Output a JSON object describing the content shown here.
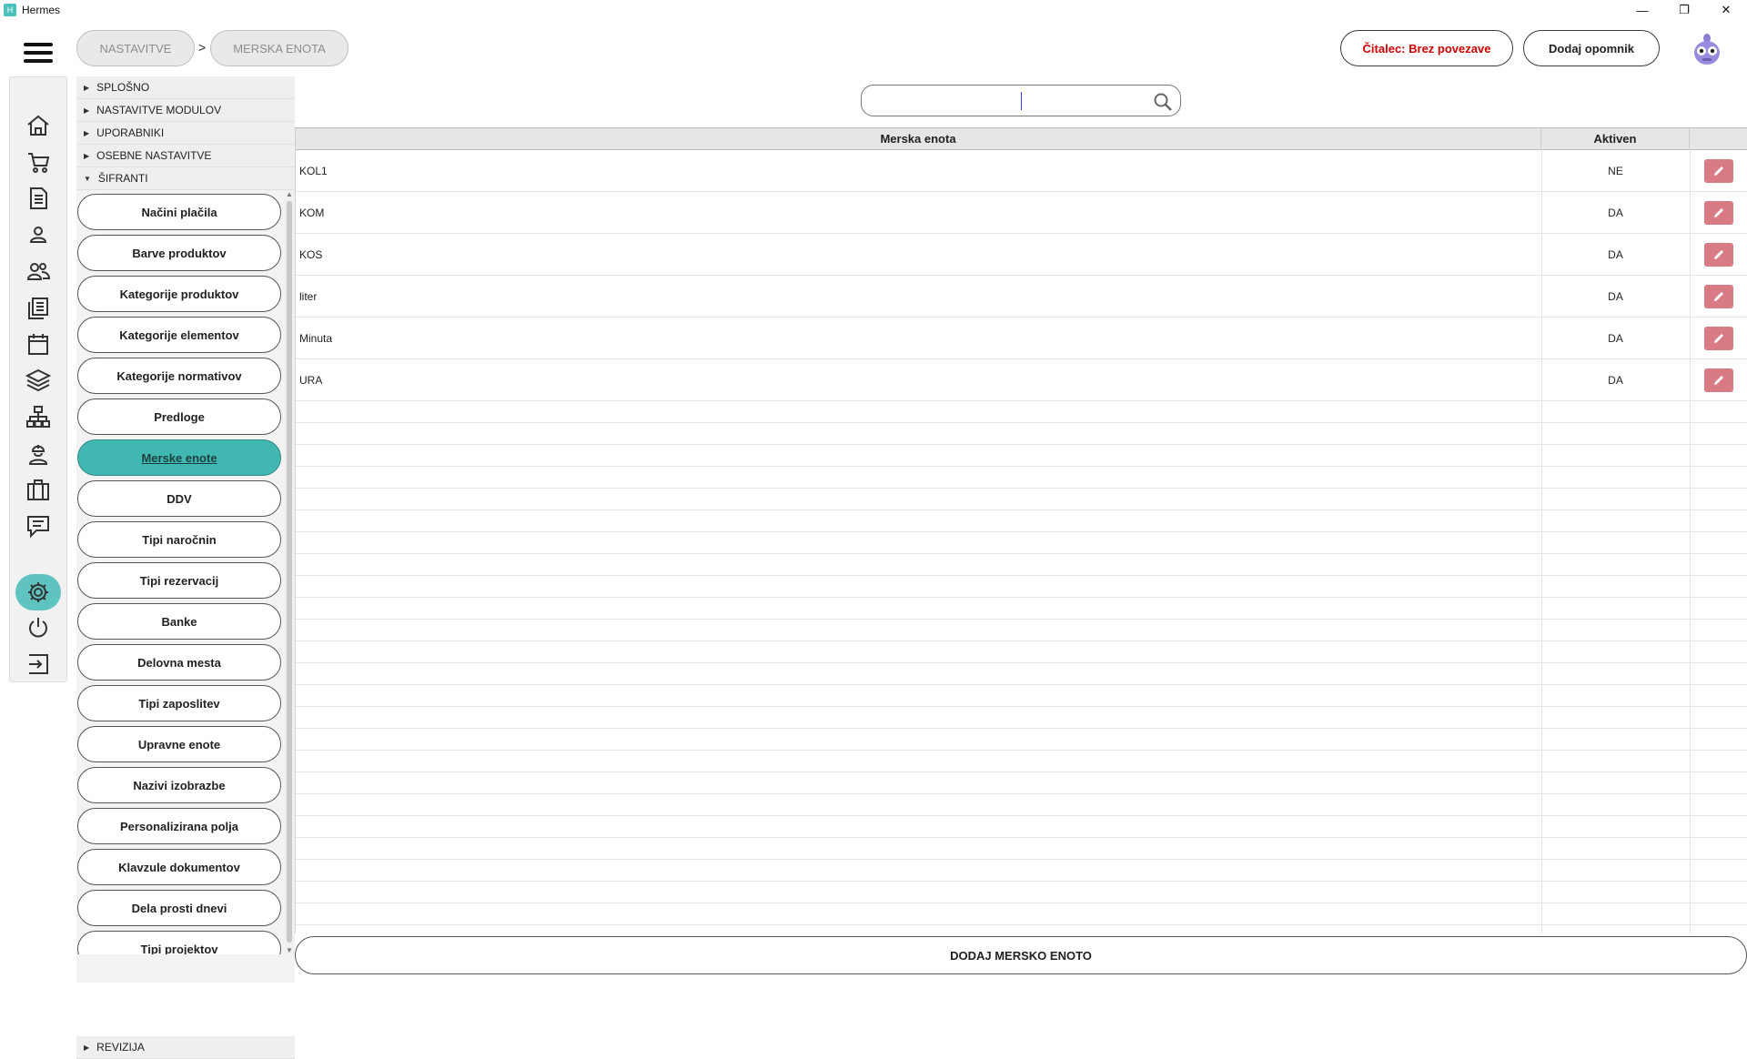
{
  "window": {
    "title": "Hermes"
  },
  "header": {
    "breadcrumb": [
      "NASTAVITVE",
      "MERSKA ENOTA"
    ],
    "breadcrumb_separator": ">",
    "reader_status": "Čitalec: Brez povezave",
    "reader_status_color": "#d10000",
    "add_reminder": "Dodaj opomnik"
  },
  "rail": {
    "icons": [
      "home-icon",
      "cart-icon",
      "invoice-icon",
      "person-icon",
      "people-icon",
      "documents-icon",
      "calendar-icon",
      "layers-icon",
      "network-icon",
      "worker-icon",
      "briefcase-icon",
      "chat-icon",
      "settings-icon",
      "power-icon",
      "logout-icon"
    ],
    "active": "settings-icon"
  },
  "tree": {
    "sections_top": [
      "SPLOŠNO",
      "NASTAVITVE MODULOV",
      "UPORABNIKI",
      "OSEBNE NASTAVITVE",
      "ŠIFRANTI"
    ],
    "expanded_section": "ŠIFRANTI",
    "items": [
      "Načini plačila",
      "Barve produktov",
      "Kategorije produktov",
      "Kategorije elementov",
      "Kategorije normativov",
      "Predloge",
      "Merske enote",
      "DDV",
      "Tipi naročnin",
      "Tipi rezervacij",
      "Banke",
      "Delovna mesta",
      "Tipi zaposlitev",
      "Upravne enote",
      "Nazivi izobrazbe",
      "Personalizirana polja",
      "Klavzule dokumentov",
      "Dela prosti dnevi",
      "Tipi projektov"
    ],
    "active_item": "Merske enote",
    "section_bottom": "REVIZIJA"
  },
  "search": {
    "value": "",
    "placeholder": ""
  },
  "grid": {
    "columns": [
      "Merska enota",
      "Aktiven"
    ],
    "rows": [
      {
        "name": "KOL1",
        "active": "NE"
      },
      {
        "name": "KOM",
        "active": "DA"
      },
      {
        "name": "KOS",
        "active": "DA"
      },
      {
        "name": "liter",
        "active": "DA"
      },
      {
        "name": "Minuta",
        "active": "DA"
      },
      {
        "name": "URA",
        "active": "DA"
      }
    ]
  },
  "footer": {
    "add_button": "DODAJ MERSKO ENOTO"
  },
  "colors": {
    "accent": "#40b8b1",
    "edit": "#d97b84"
  }
}
